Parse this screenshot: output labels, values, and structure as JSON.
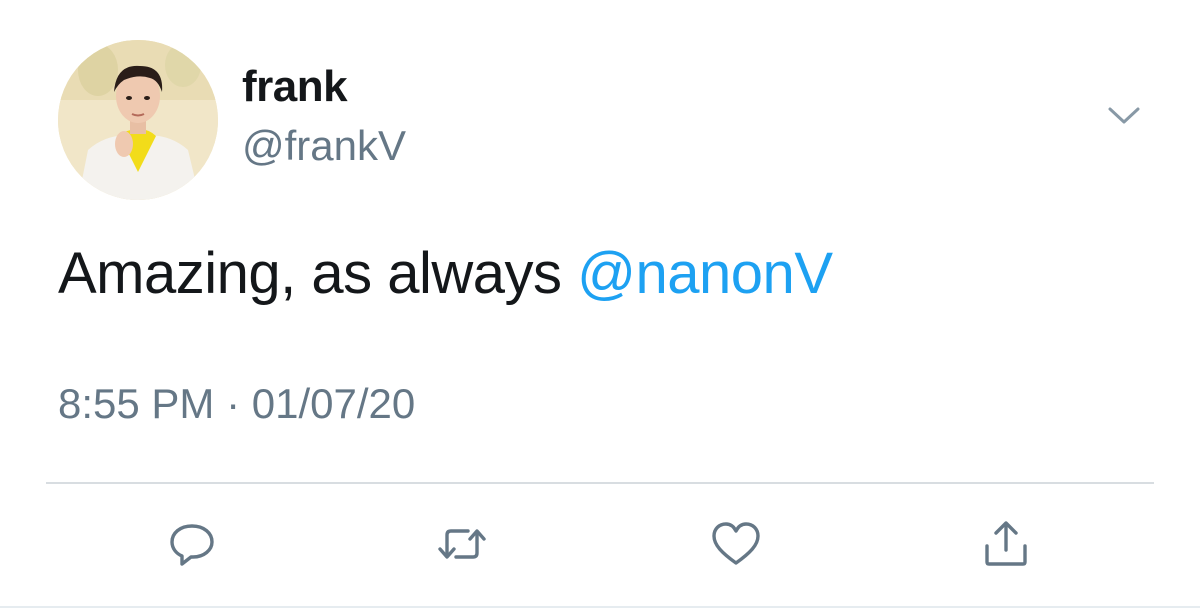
{
  "tweet": {
    "display_name": "frank",
    "handle": "@frankV",
    "text_prefix": "Amazing, as always ",
    "mention": "@nanonV",
    "timestamp": "8:55 PM · 01/07/20"
  },
  "icons": {
    "menu": "chevron-down-icon",
    "reply": "reply-bubble-icon",
    "retweet": "retweet-icon",
    "like": "heart-icon",
    "share": "share-upload-icon"
  },
  "colors": {
    "text": "#14171a",
    "secondary": "#657786",
    "link": "#1da1f2",
    "divider": "#d8dde1"
  }
}
